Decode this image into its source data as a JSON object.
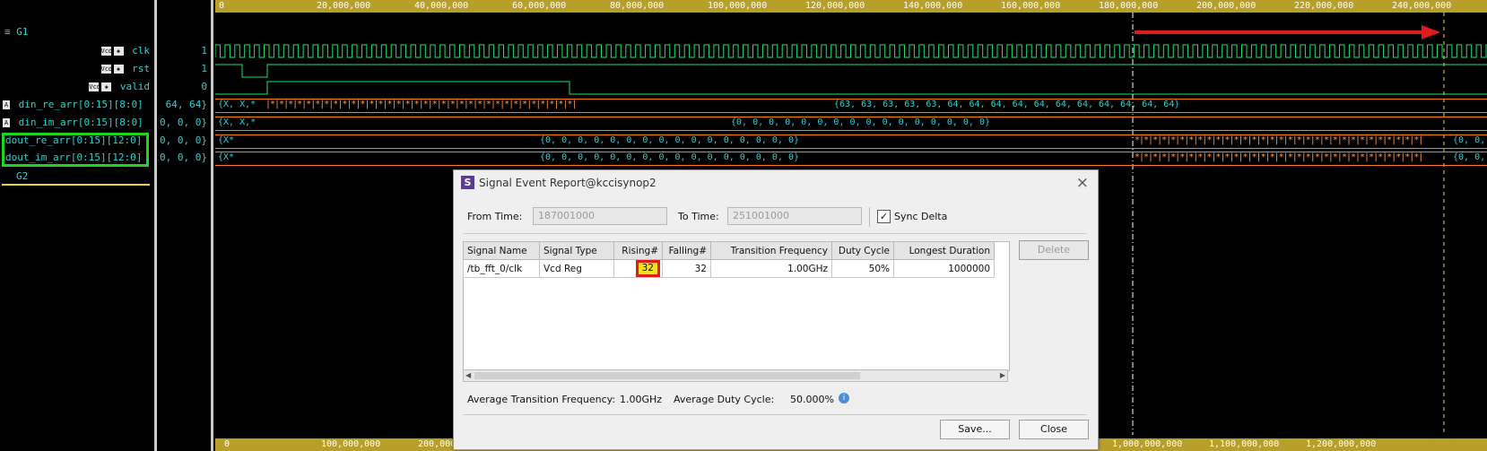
{
  "name_panel": {
    "group1": "G1",
    "group2": "G2",
    "signals": [
      {
        "name": "clk",
        "badge": "Vcd",
        "value": "1"
      },
      {
        "name": "rst",
        "badge": "Vcd",
        "value": "1"
      },
      {
        "name": "valid",
        "badge": "Vcd",
        "value": "0"
      },
      {
        "name": "din_re_arr[0:15][8:0]",
        "value": "64, 64}"
      },
      {
        "name": "din_im_arr[0:15][8:0]",
        "value": "0, 0, 0}"
      },
      {
        "name": "dout_re_arr[0:15][12:0]",
        "value": "0, 0, 0}"
      },
      {
        "name": "dout_im_arr[0:15][12:0]",
        "value": "0, 0, 0}"
      }
    ]
  },
  "top_ruler": {
    "ticks": [
      "0",
      "20,000,000",
      "40,000,000",
      "60,000,000",
      "80,000,000",
      "100,000,000",
      "120,000,000",
      "140,000,000",
      "160,000,000",
      "180,000,000",
      "200,000,000",
      "220,000,000",
      "240,000,000"
    ]
  },
  "bottom_ruler": {
    "ticks": [
      "0",
      "100,000,000",
      "200,000,000",
      "1,000,000,000",
      "1,100,000,000",
      "1,200,000,000"
    ]
  },
  "waves": {
    "din_re_start": "{X, X,*",
    "din_re_value": "{63, 63, 63, 63, 63, 64, 64, 64, 64, 64, 64, 64, 64, 64, 64, 64}",
    "din_im_start": "{X, X,*",
    "din_im_value": "{0, 0, 0, 0, 0, 0, 0, 0, 0, 0, 0, 0, 0, 0, 0, 0}",
    "dout_re_start": "{X*",
    "dout_re_value": "{0, 0, 0, 0, 0, 0, 0, 0, 0, 0, 0, 0, 0, 0, 0, 0}",
    "dout_re_end": "{0, 0,",
    "dout_im_start": "{X*",
    "dout_im_value": "{0, 0, 0, 0, 0, 0, 0, 0, 0, 0, 0, 0, 0, 0, 0, 0}",
    "dout_im_end": "{0, 0,"
  },
  "dialog": {
    "title": "Signal Event Report@kccisynop2",
    "logo": "S",
    "close_glyph": "×",
    "from_time_label": "From Time:",
    "from_time_value": "187001000",
    "to_time_label": "To Time:",
    "to_time_value": "251001000",
    "sync_delta_label": "Sync Delta",
    "sync_delta_checked": true,
    "columns": [
      "Signal Name",
      "Signal Type",
      "Rising#",
      "Falling#",
      "Transition Frequency",
      "Duty Cycle",
      "Longest Duration"
    ],
    "rows": [
      {
        "signal_name": "/tb_fft_0/clk",
        "signal_type": "Vcd Reg",
        "rising": "32",
        "falling": "32",
        "transition_frequency": "1.00GHz",
        "duty_cycle": "50%",
        "longest_duration": "1000000"
      }
    ],
    "delete_label": "Delete",
    "avg_freq_label": "Average Transition Frequency:",
    "avg_freq_value": "1.00GHz",
    "avg_duty_label": "Average Duty Cycle:",
    "avg_duty_value": "50.000%",
    "save_label": "Save...",
    "close_label": "Close"
  },
  "colors": {
    "accent_red": "#e01b1b",
    "highlight_green": "#21d421",
    "bus_orange": "#ff7a1a",
    "ruler_gold": "#b89f2a",
    "wave_green": "#20e070",
    "highlight_yellow": "#f5e11a"
  }
}
